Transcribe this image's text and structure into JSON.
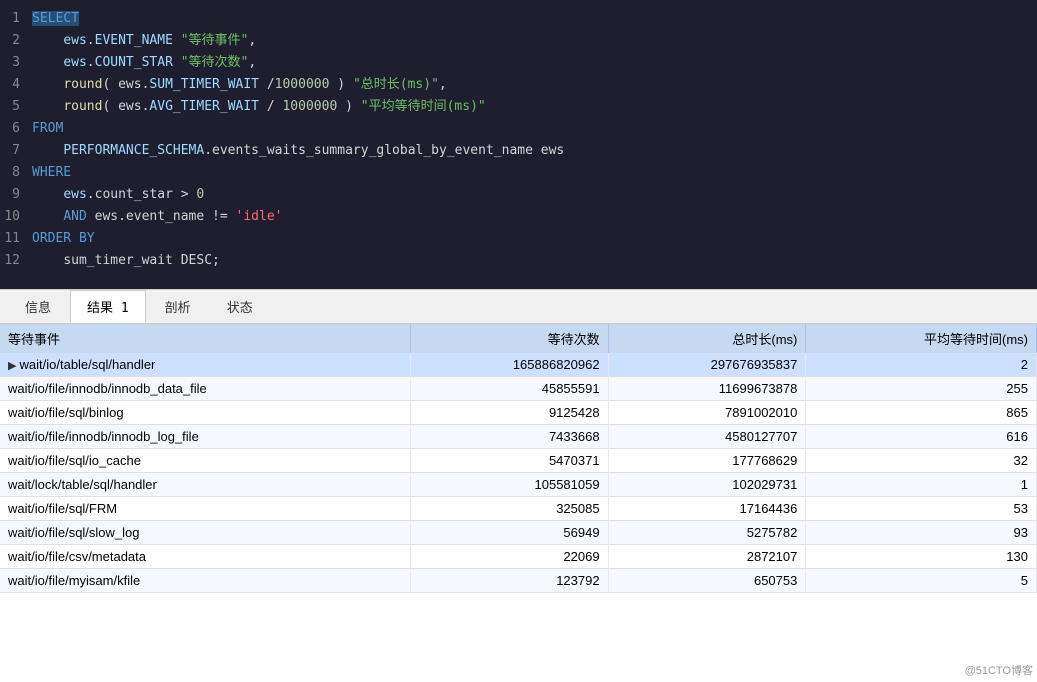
{
  "editor": {
    "lines": [
      {
        "num": 1,
        "tokens": [
          {
            "text": "SELECT",
            "cls": "kw-blue highlight-select"
          }
        ]
      },
      {
        "num": 2,
        "indent": "    ",
        "tokens": [
          {
            "text": "ews",
            "cls": "ident-light"
          },
          {
            "text": ".",
            "cls": "punct"
          },
          {
            "text": "EVENT_NAME",
            "cls": "ident-light"
          },
          {
            "text": " ",
            "cls": ""
          },
          {
            "text": "\"等待事件\"",
            "cls": "str-green"
          },
          {
            "text": ",",
            "cls": "punct"
          }
        ]
      },
      {
        "num": 3,
        "indent": "    ",
        "tokens": [
          {
            "text": "ews",
            "cls": "ident-light"
          },
          {
            "text": ".",
            "cls": "punct"
          },
          {
            "text": "COUNT_STAR",
            "cls": "ident-light"
          },
          {
            "text": " ",
            "cls": ""
          },
          {
            "text": "\"等待次数\"",
            "cls": "str-green"
          },
          {
            "text": ",",
            "cls": "punct"
          }
        ]
      },
      {
        "num": 4,
        "indent": "    ",
        "tokens": [
          {
            "text": "round",
            "cls": "fn-yellow"
          },
          {
            "text": "( ews.",
            "cls": "punct"
          },
          {
            "text": "SUM_TIMER_WAIT",
            "cls": "ident-light"
          },
          {
            "text": " /",
            "cls": "punct"
          },
          {
            "text": "1000000",
            "cls": "num-orange"
          },
          {
            "text": " ) ",
            "cls": "punct"
          },
          {
            "text": "\"总时长(ms)\"",
            "cls": "str-green"
          },
          {
            "text": ",",
            "cls": "punct"
          }
        ]
      },
      {
        "num": 5,
        "indent": "    ",
        "tokens": [
          {
            "text": "round",
            "cls": "fn-yellow"
          },
          {
            "text": "( ews.",
            "cls": "punct"
          },
          {
            "text": "AVG_TIMER_WAIT",
            "cls": "ident-light"
          },
          {
            "text": " / ",
            "cls": "punct"
          },
          {
            "text": "1000000",
            "cls": "num-orange"
          },
          {
            "text": " ) ",
            "cls": "punct"
          },
          {
            "text": "\"平均等待时间(ms)\"",
            "cls": "str-green"
          }
        ]
      },
      {
        "num": 6,
        "tokens": [
          {
            "text": "FROM",
            "cls": "kw-blue"
          }
        ]
      },
      {
        "num": 7,
        "indent": "    ",
        "tokens": [
          {
            "text": "PERFORMANCE_SCHEMA",
            "cls": "ident-light"
          },
          {
            "text": ".events_waits_summary_global_by_event_name ews",
            "cls": "ident-white"
          }
        ]
      },
      {
        "num": 8,
        "tokens": [
          {
            "text": "WHERE",
            "cls": "kw-blue"
          }
        ]
      },
      {
        "num": 9,
        "indent": "    ",
        "tokens": [
          {
            "text": "ews",
            "cls": "ident-light"
          },
          {
            "text": ".count_star > ",
            "cls": "ident-white"
          },
          {
            "text": "0",
            "cls": "num-orange"
          }
        ]
      },
      {
        "num": 10,
        "indent": "    ",
        "tokens": [
          {
            "text": "AND",
            "cls": "kw-blue"
          },
          {
            "text": " ews.event_name != ",
            "cls": "ident-white"
          },
          {
            "text": "'idle'",
            "cls": "str-red"
          }
        ]
      },
      {
        "num": 11,
        "tokens": [
          {
            "text": "ORDER BY",
            "cls": "kw-blue"
          }
        ]
      },
      {
        "num": 12,
        "indent": "    ",
        "tokens": [
          {
            "text": "sum_timer_wait DESC;",
            "cls": "ident-white"
          }
        ]
      }
    ]
  },
  "tabs": {
    "items": [
      {
        "label": "信息",
        "active": false
      },
      {
        "label": "结果 1",
        "active": true
      },
      {
        "label": "剖析",
        "active": false
      },
      {
        "label": "状态",
        "active": false
      }
    ]
  },
  "table": {
    "columns": [
      "等待事件",
      "等待次数",
      "总时长(ms)",
      "平均等待时间(ms)"
    ],
    "rows": [
      {
        "indicator": "▶",
        "event": "wait/io/table/sql/handler",
        "count": "165886820962",
        "total": "297676935837",
        "avg": "2"
      },
      {
        "indicator": "",
        "event": "wait/io/file/innodb/innodb_data_file",
        "count": "45855591",
        "total": "11699673878",
        "avg": "255"
      },
      {
        "indicator": "",
        "event": "wait/io/file/sql/binlog",
        "count": "9125428",
        "total": "7891002010",
        "avg": "865"
      },
      {
        "indicator": "",
        "event": "wait/io/file/innodb/innodb_log_file",
        "count": "7433668",
        "total": "4580127707",
        "avg": "616"
      },
      {
        "indicator": "",
        "event": "wait/io/file/sql/io_cache",
        "count": "5470371",
        "total": "177768629",
        "avg": "32"
      },
      {
        "indicator": "",
        "event": "wait/lock/table/sql/handler",
        "count": "105581059",
        "total": "102029731",
        "avg": "1"
      },
      {
        "indicator": "",
        "event": "wait/io/file/sql/FRM",
        "count": "325085",
        "total": "17164436",
        "avg": "53"
      },
      {
        "indicator": "",
        "event": "wait/io/file/sql/slow_log",
        "count": "56949",
        "total": "5275782",
        "avg": "93"
      },
      {
        "indicator": "",
        "event": "wait/io/file/csv/metadata",
        "count": "22069",
        "total": "2872107",
        "avg": "130"
      },
      {
        "indicator": "",
        "event": "wait/io/file/myisam/kfile",
        "count": "123792",
        "total": "650753",
        "avg": "5"
      }
    ]
  },
  "watermark": "@51CTO博客"
}
